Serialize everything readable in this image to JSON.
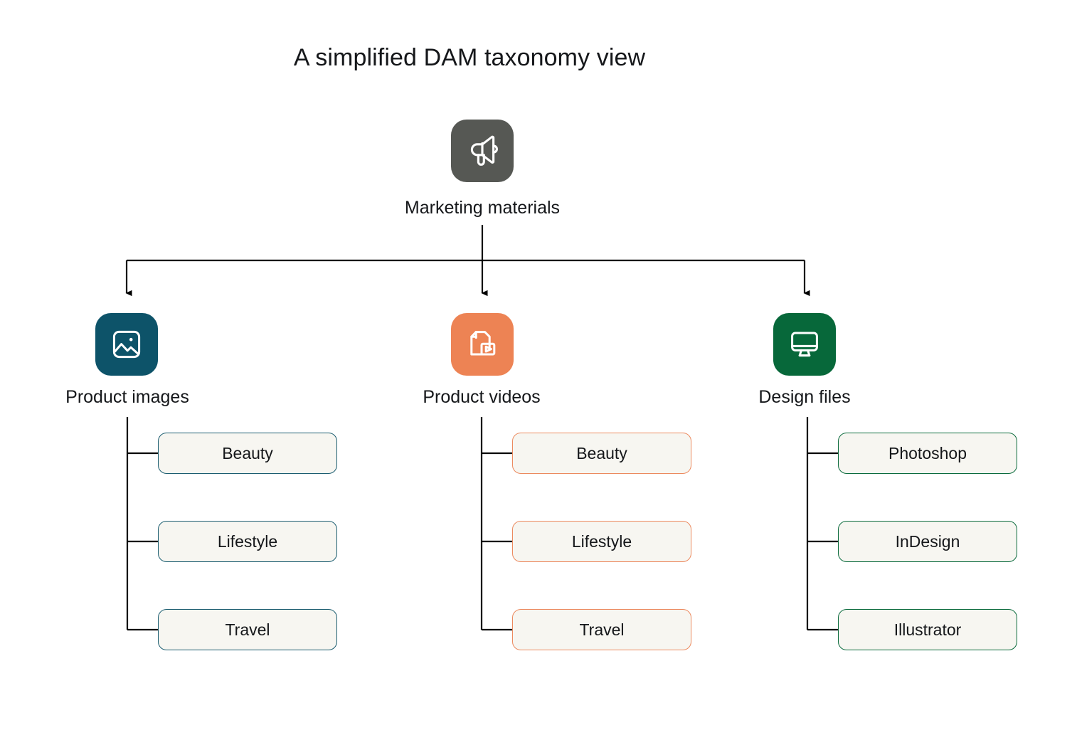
{
  "title": "A simplified DAM taxonomy view",
  "colors": {
    "background": "#ffffff",
    "text": "#15171a",
    "connector": "#000000",
    "root_tile": "#565854",
    "images_tile": "#0d5369",
    "videos_tile": "#ed8354",
    "design_tile": "#07683a",
    "leaf_fill": "#f7f6f1",
    "leaf_border_teal": "#1b5d70",
    "leaf_border_orange": "#ec8a5f",
    "leaf_border_green": "#0b6b3d"
  },
  "root": {
    "label": "Marketing materials",
    "icon": "megaphone-icon",
    "tile_color": "#565854"
  },
  "branches": [
    {
      "label": "Product images",
      "icon": "image-icon",
      "tile_color": "#0d5369",
      "accent": "teal",
      "children": [
        {
          "label": "Beauty"
        },
        {
          "label": "Lifestyle"
        },
        {
          "label": "Travel"
        }
      ]
    },
    {
      "label": "Product videos",
      "icon": "video-document-icon",
      "tile_color": "#ed8354",
      "accent": "orange",
      "children": [
        {
          "label": "Beauty"
        },
        {
          "label": "Lifestyle"
        },
        {
          "label": "Travel"
        }
      ]
    },
    {
      "label": "Design files",
      "icon": "monitor-icon",
      "tile_color": "#07683a",
      "accent": "green",
      "children": [
        {
          "label": "Photoshop"
        },
        {
          "label": "InDesign"
        },
        {
          "label": "Illustrator"
        }
      ]
    }
  ]
}
